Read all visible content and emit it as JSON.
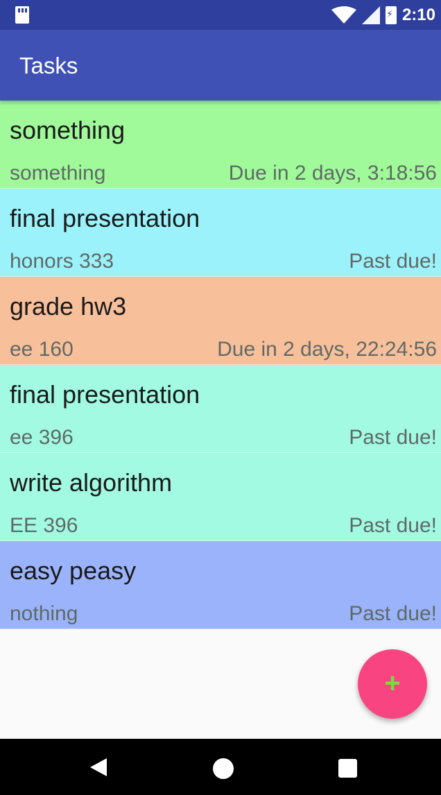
{
  "status_bar": {
    "time": "2:10",
    "icons": [
      "sd-card-icon",
      "wifi-icon",
      "signal-icon",
      "battery-charging-icon"
    ]
  },
  "app_bar": {
    "title": "Tasks"
  },
  "tasks": [
    {
      "title": "something",
      "subject": "something",
      "due": "Due in 2 days, 3:18:56",
      "color": "#a0fa9a"
    },
    {
      "title": "final presentation",
      "subject": "honors 333",
      "due": "Past due!",
      "color": "#9cf2fb"
    },
    {
      "title": "grade hw3",
      "subject": "ee 160",
      "due": "Due in 2 days, 22:24:56",
      "color": "#f8bf9b"
    },
    {
      "title": "final presentation",
      "subject": "ee 396",
      "due": "Past due!",
      "color": "#a2fae2"
    },
    {
      "title": "write algorithm",
      "subject": "EE 396",
      "due": "Past due!",
      "color": "#a2fae2"
    },
    {
      "title": "easy peasy",
      "subject": "nothing",
      "due": "Past due!",
      "color": "#9bb3fa"
    }
  ],
  "fab": {
    "label": "+",
    "icon": "plus-icon",
    "color": "#f94482"
  },
  "nav_bar": {
    "icons": [
      "back-icon",
      "home-icon",
      "recents-icon"
    ]
  }
}
